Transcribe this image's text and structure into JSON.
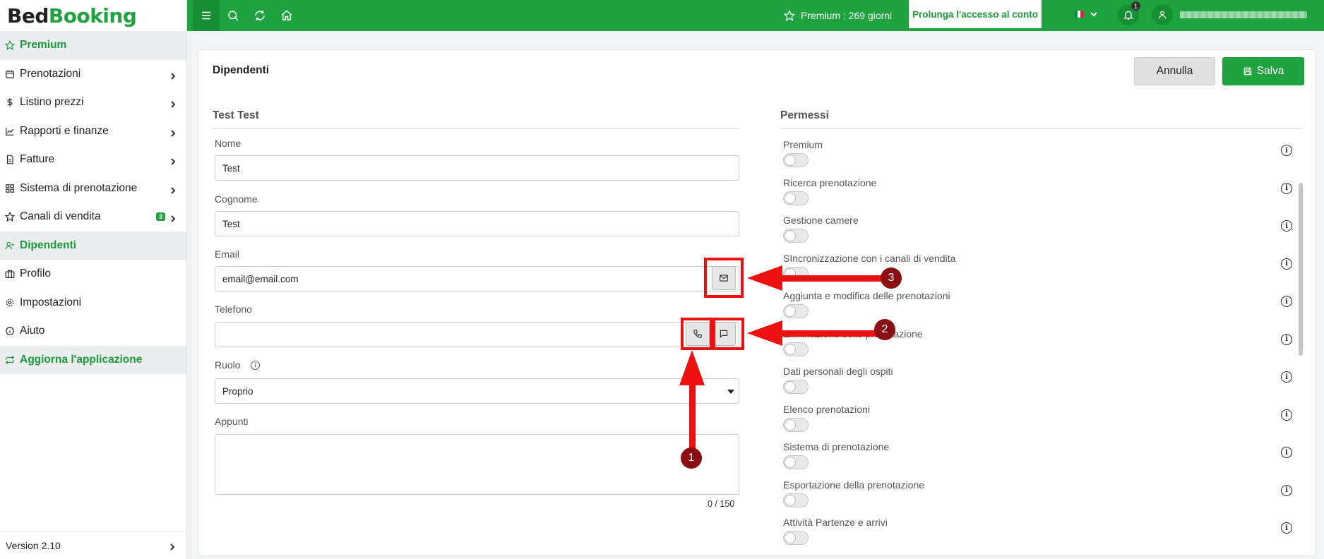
{
  "brand": {
    "part1": "Bed",
    "part2": "Booking"
  },
  "sidebar": {
    "items": [
      {
        "label": "Premium"
      },
      {
        "label": "Prenotazioni"
      },
      {
        "label": "Listino prezzi"
      },
      {
        "label": "Rapporti e finanze"
      },
      {
        "label": "Fatture"
      },
      {
        "label": "Sistema di prenotazione"
      },
      {
        "label": "Canali di vendita",
        "badge": "3"
      },
      {
        "label": "Dipendenti"
      },
      {
        "label": "Profilo"
      },
      {
        "label": "Impostazioni"
      },
      {
        "label": "Aiuto"
      },
      {
        "label": "Aggiorna l'applicazione"
      }
    ],
    "version": "Version 2.10"
  },
  "topbar": {
    "premium_text": "Premium : 269 giorni",
    "extend_button": "Prolunga l'accesso al conto",
    "notification_count": "1",
    "flag_colors": [
      "#009246",
      "#ffffff",
      "#ce2b37"
    ]
  },
  "page": {
    "title": "Dipendenti",
    "cancel_label": "Annulla",
    "save_label": "Salva"
  },
  "employee": {
    "section_title": "Test Test",
    "fields": {
      "nome_label": "Nome",
      "nome_value": "Test",
      "cognome_label": "Cognome",
      "cognome_value": "Test",
      "email_label": "Email",
      "email_value": "email@email.com",
      "telefono_label": "Telefono",
      "telefono_value": "",
      "ruolo_label": "Ruolo",
      "ruolo_value": "Proprio",
      "appunti_label": "Appunti",
      "appunti_counter": "0 / 150"
    }
  },
  "permissions": {
    "section_title": "Permessi",
    "items": [
      {
        "label": "Premium",
        "enabled": false
      },
      {
        "label": "Ricerca prenotazione",
        "enabled": false
      },
      {
        "label": "Gestione camere",
        "enabled": false
      },
      {
        "label": "SIncronizzazione con i canali di vendita",
        "enabled": false
      },
      {
        "label": "Aggiunta e modifica delle prenotazioni",
        "enabled": false
      },
      {
        "label": "Eliminazione delle prenotazione",
        "enabled": false
      },
      {
        "label": "Dati personali degli ospiti",
        "enabled": false
      },
      {
        "label": "Elenco prenotazioni",
        "enabled": false
      },
      {
        "label": "Sistema di prenotazione",
        "enabled": false
      },
      {
        "label": "Esportazione della prenotazione",
        "enabled": false
      },
      {
        "label": "Attività Partenze e arrivi",
        "enabled": false
      }
    ]
  },
  "annotations": {
    "n1": "1",
    "n2": "2",
    "n3": "3",
    "color": "#ee1111"
  }
}
